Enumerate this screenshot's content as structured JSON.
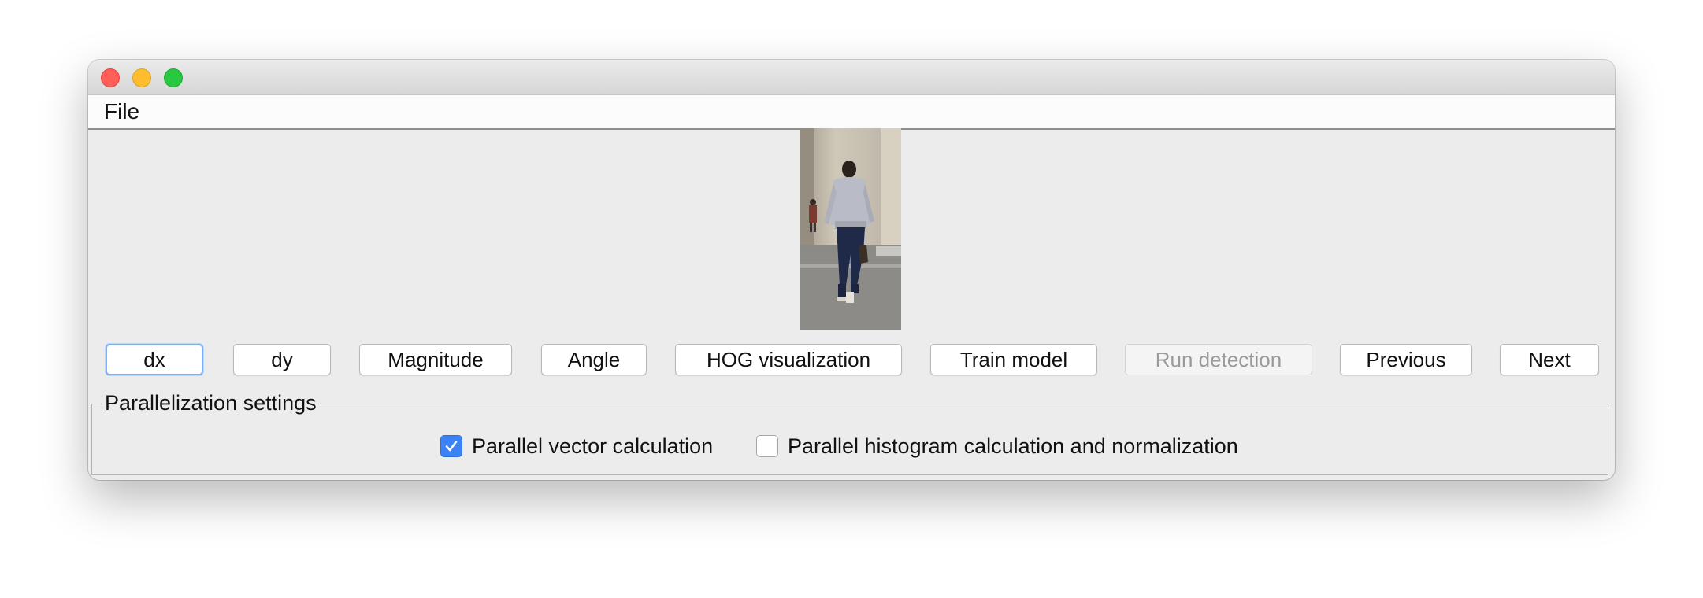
{
  "window": {
    "controls": [
      "close",
      "minimize",
      "zoom"
    ]
  },
  "menubar": {
    "file_label": "File"
  },
  "image": {
    "description_icon": "pedestrian-photo"
  },
  "buttons": {
    "dx": "dx",
    "dy": "dy",
    "magnitude": "Magnitude",
    "angle": "Angle",
    "hog": "HOG visualization",
    "train": "Train model",
    "run": "Run detection",
    "previous": "Previous",
    "next": "Next"
  },
  "parallelization": {
    "title": "Parallelization settings",
    "vector_label": "Parallel vector calculation",
    "vector_checked": true,
    "histogram_label": "Parallel histogram calculation and normalization",
    "histogram_checked": false
  },
  "colors": {
    "accent": "#3b82f6",
    "focus_ring": "#7ab0f5",
    "close": "#ff5f57",
    "minimize": "#febc2e",
    "zoom": "#28c840"
  }
}
